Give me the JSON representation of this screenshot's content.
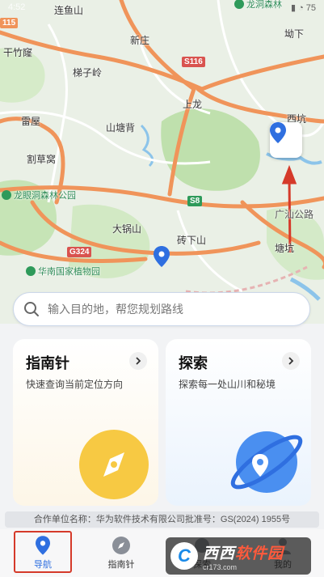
{
  "status_bar": {
    "time": "4:52",
    "icons": "▮ ◔ 75"
  },
  "map": {
    "labels": [
      {
        "key": "lianyushan",
        "text": "连鱼山"
      },
      {
        "key": "xinzhuang",
        "text": "新庄"
      },
      {
        "key": "aoxia",
        "text": "坳下"
      },
      {
        "key": "ganzhuling",
        "text": "干竹窿"
      },
      {
        "key": "tizixing",
        "text": "梯子岭"
      },
      {
        "key": "shanglong",
        "text": "上龙"
      },
      {
        "key": "xikeng",
        "text": "西坑"
      },
      {
        "key": "leiwu",
        "text": "雷屋"
      },
      {
        "key": "shantangbei",
        "text": "山塘背"
      },
      {
        "key": "gecaowo",
        "text": "割草窝"
      },
      {
        "key": "daguoshan",
        "text": "大锅山"
      },
      {
        "key": "zhuanxiashan",
        "text": "砖下山"
      },
      {
        "key": "tangkeng",
        "text": "塘坑"
      },
      {
        "key": "shanroad",
        "text": "广汕公路"
      }
    ],
    "pois": [
      {
        "key": "longdong",
        "text": "龙眼洞森林公园"
      },
      {
        "key": "botanic",
        "text": "华南国家植物园"
      },
      {
        "key": "top",
        "text": "龙洞森林"
      }
    ],
    "roads": [
      {
        "key": "s116",
        "text": "S116"
      },
      {
        "key": "s8",
        "text": "S8"
      },
      {
        "key": "g324",
        "text": "G324"
      },
      {
        "key": "r115",
        "text": "115"
      }
    ]
  },
  "search": {
    "placeholder": "输入目的地，帮您规划路线"
  },
  "cards": [
    {
      "title": "指南针",
      "desc": "快速查询当前定位方向"
    },
    {
      "title": "探索",
      "desc": "探索每一处山川和秘境"
    }
  ],
  "license": "合作单位名称：华为软件技术有限公司批准号：GS(2024) 1955号",
  "tabs": [
    {
      "label": "导航",
      "icon": "location-pin-icon"
    },
    {
      "label": "指南针",
      "icon": "compass-icon"
    },
    {
      "label": "探索",
      "icon": "planet-icon"
    },
    {
      "label": "我的",
      "icon": "user-icon"
    }
  ],
  "watermark": {
    "title_a": "西西",
    "title_b": "软件园",
    "url": "cr173.com"
  },
  "colors": {
    "accent": "#2f6fe0",
    "highlight": "#d53a2a",
    "road": "#f0945a",
    "green": "#a9d39a"
  }
}
